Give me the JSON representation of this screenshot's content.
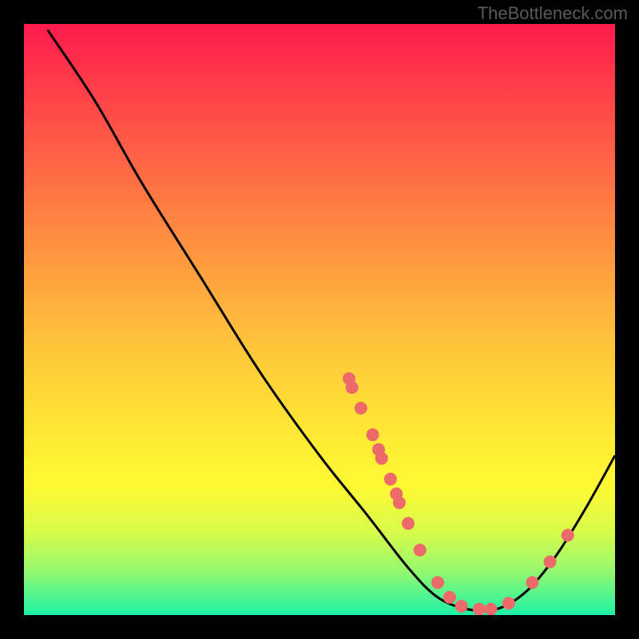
{
  "watermark": "TheBottleneck.com",
  "chart_data": {
    "type": "line",
    "title": "",
    "xlabel": "",
    "ylabel": "",
    "xlim": [
      0,
      100
    ],
    "ylim": [
      0,
      100
    ],
    "curve": [
      {
        "x": 4,
        "y": 99
      },
      {
        "x": 12,
        "y": 87
      },
      {
        "x": 20,
        "y": 73
      },
      {
        "x": 30,
        "y": 57
      },
      {
        "x": 40,
        "y": 41
      },
      {
        "x": 50,
        "y": 27
      },
      {
        "x": 58,
        "y": 17
      },
      {
        "x": 65,
        "y": 8
      },
      {
        "x": 70,
        "y": 3
      },
      {
        "x": 75,
        "y": 1
      },
      {
        "x": 80,
        "y": 1
      },
      {
        "x": 85,
        "y": 4
      },
      {
        "x": 90,
        "y": 10
      },
      {
        "x": 95,
        "y": 18
      },
      {
        "x": 100,
        "y": 27
      }
    ],
    "markers": [
      {
        "x": 55,
        "y": 40
      },
      {
        "x": 55.5,
        "y": 38.5
      },
      {
        "x": 57,
        "y": 35
      },
      {
        "x": 59,
        "y": 30.5
      },
      {
        "x": 60,
        "y": 28
      },
      {
        "x": 60.5,
        "y": 26.5
      },
      {
        "x": 62,
        "y": 23
      },
      {
        "x": 63,
        "y": 20.5
      },
      {
        "x": 63.5,
        "y": 19
      },
      {
        "x": 65,
        "y": 15.5
      },
      {
        "x": 67,
        "y": 11
      },
      {
        "x": 70,
        "y": 5.5
      },
      {
        "x": 72,
        "y": 3
      },
      {
        "x": 74,
        "y": 1.5
      },
      {
        "x": 77,
        "y": 1
      },
      {
        "x": 79,
        "y": 1
      },
      {
        "x": 82,
        "y": 2
      },
      {
        "x": 86,
        "y": 5.5
      },
      {
        "x": 89,
        "y": 9
      },
      {
        "x": 92,
        "y": 13.5
      }
    ],
    "marker_color": "#ec6a6a",
    "curve_color": "#000000",
    "gradient_top": "#ff1a4d",
    "gradient_bottom": "#18f0a8"
  }
}
